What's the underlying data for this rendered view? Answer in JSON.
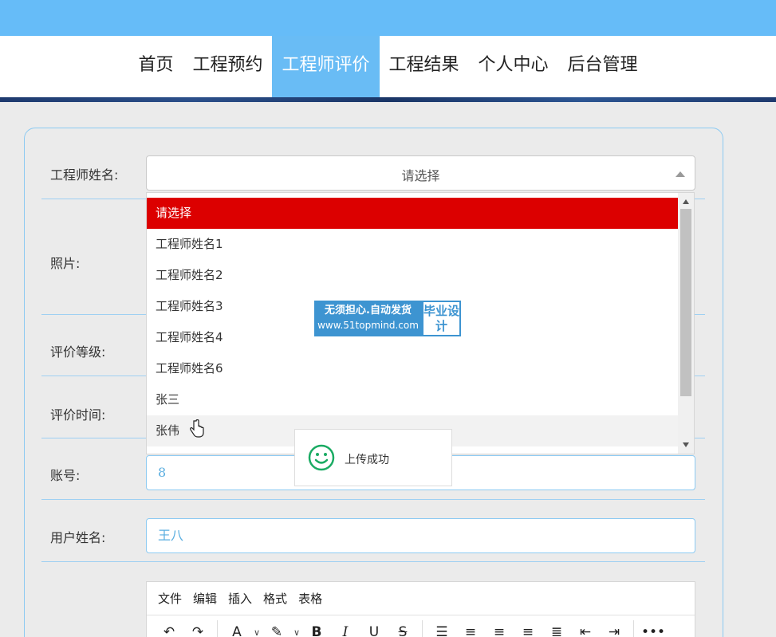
{
  "nav": {
    "items": [
      "首页",
      "工程预约",
      "工程师评价",
      "工程结果",
      "个人中心",
      "后台管理"
    ],
    "active": "工程师评价"
  },
  "form": {
    "engineer_label": "工程师姓名:",
    "photo_label": "照片:",
    "rating_label": "评价等级:",
    "time_label": "评价时间:",
    "account_label": "账号:",
    "username_label": "用户姓名:",
    "account_value": "8",
    "username_value": "王八"
  },
  "select": {
    "value": "请选择",
    "options": [
      "请选择",
      "工程师姓名1",
      "工程师姓名2",
      "工程师姓名3",
      "工程师姓名4",
      "工程师姓名6",
      "张三",
      "张伟"
    ]
  },
  "toast": {
    "text": "上传成功",
    "color": "#1aab63"
  },
  "watermark": {
    "line1": "无须担心.自动发货",
    "line2": "www.51topmind.com",
    "side": "毕业设计"
  },
  "editor": {
    "menu": [
      "文件",
      "编辑",
      "插入",
      "格式",
      "表格"
    ],
    "tools": [
      "undo-icon",
      "redo-icon",
      "font-color-icon",
      "highlight-icon",
      "bold-icon",
      "italic-icon",
      "underline-icon",
      "strikethrough-icon",
      "line-height-icon",
      "align-left-icon",
      "align-center-icon",
      "align-right-icon",
      "align-justify-icon",
      "outdent-icon",
      "indent-icon",
      "more-icon"
    ]
  },
  "colors": {
    "accent": "#66bcf8",
    "selected_option": "#dc0000"
  }
}
